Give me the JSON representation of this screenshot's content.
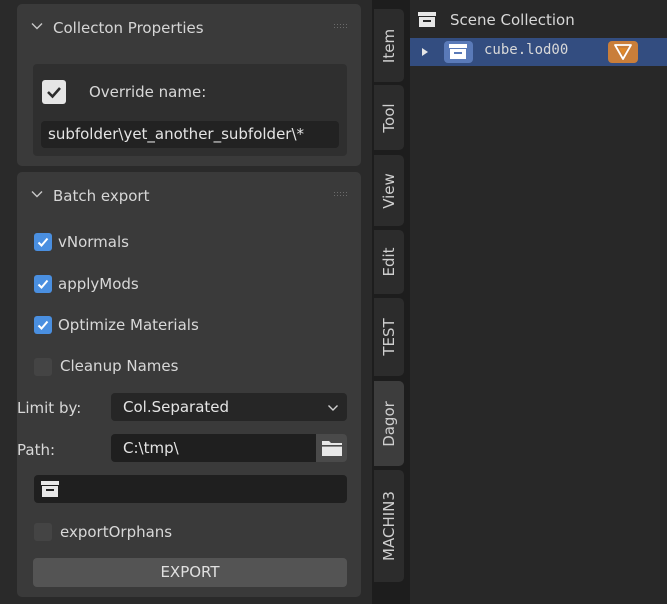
{
  "collection_panel": {
    "title": "Collecton Properties",
    "override_label": "Override name:",
    "override_checked": true,
    "override_value": "subfolder\\yet_another_subfolder\\*"
  },
  "batch_panel": {
    "title": "Batch export",
    "options": [
      {
        "label": "vNormals",
        "checked": true
      },
      {
        "label": "applyMods",
        "checked": true
      },
      {
        "label": "Optimize Materials",
        "checked": true
      },
      {
        "label": "Cleanup Names",
        "checked": false
      }
    ],
    "limit_label": "Limit by:",
    "limit_value": "Col.Separated",
    "path_label": "Path:",
    "path_value": "C:\\tmp\\",
    "collection_field_value": "",
    "export_orphans_label": "exportOrphans",
    "export_orphans_checked": false,
    "export_button": "EXPORT"
  },
  "tabs": [
    "Item",
    "Tool",
    "View",
    "Edit",
    "TEST",
    "Dagor",
    "MACHIN3"
  ],
  "active_tab": "Dagor",
  "outliner": {
    "root_label": "Scene Collection",
    "items": [
      {
        "label": "cube.lod00",
        "selected": true
      }
    ]
  },
  "colors": {
    "accent_blue": "#4a8fe0",
    "selection": "#334d80",
    "object_orange": "#e0892a"
  }
}
